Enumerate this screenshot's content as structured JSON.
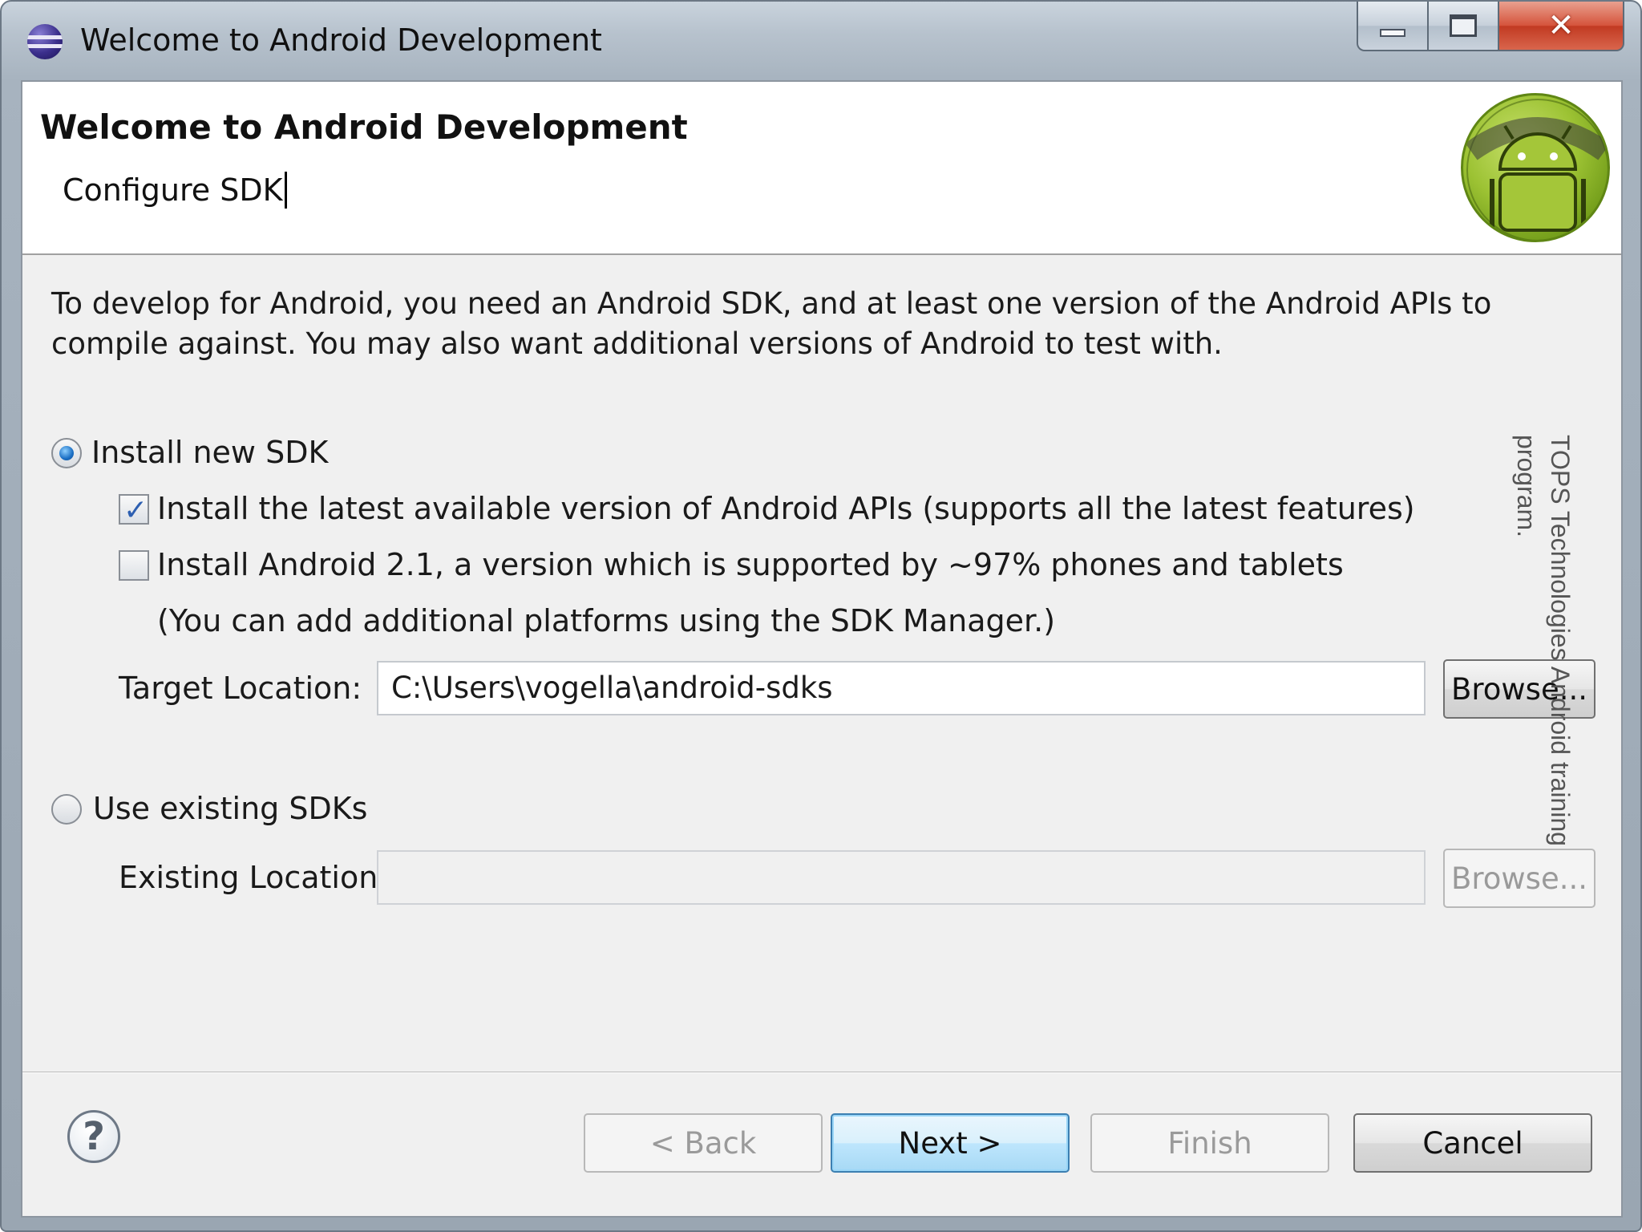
{
  "window": {
    "title": "Welcome to Android Development",
    "controls": {
      "minimize": "minimize",
      "maximize": "maximize",
      "close": "✕"
    }
  },
  "header": {
    "title": "Welcome to Android Development",
    "subtitle": "Configure SDK",
    "logo": "android-logo"
  },
  "description": "To develop for Android, you need an Android SDK, and at least one version of the Android APIs to compile against. You may also want additional versions of Android to test with.",
  "install_new": {
    "label": "Install new SDK",
    "selected": true,
    "options": [
      {
        "label": "Install the latest available version of Android APIs (supports all the latest features)",
        "checked": true
      },
      {
        "label": "Install Android 2.1, a version which is supported by ~97% phones and tablets",
        "checked": false
      }
    ],
    "note": "(You can add additional platforms using the SDK Manager.)",
    "target_label": "Target Location:",
    "target_value": "C:\\Users\\vogella\\android-sdks",
    "browse_label": "Browse..."
  },
  "use_existing": {
    "label": "Use existing SDKs",
    "selected": false,
    "existing_label": "Existing Location:",
    "existing_value": "",
    "browse_label": "Browse..."
  },
  "footer": {
    "help_icon": "?",
    "back_label": "< Back",
    "next_label": "Next >",
    "finish_label": "Finish",
    "cancel_label": "Cancel"
  },
  "watermark": {
    "line1": "TOPS Technologies Android training",
    "line2": "program."
  },
  "colors": {
    "accent_default_button": "#bee6fd",
    "android_green": "#9cc233",
    "close_button": "#c13a22"
  }
}
